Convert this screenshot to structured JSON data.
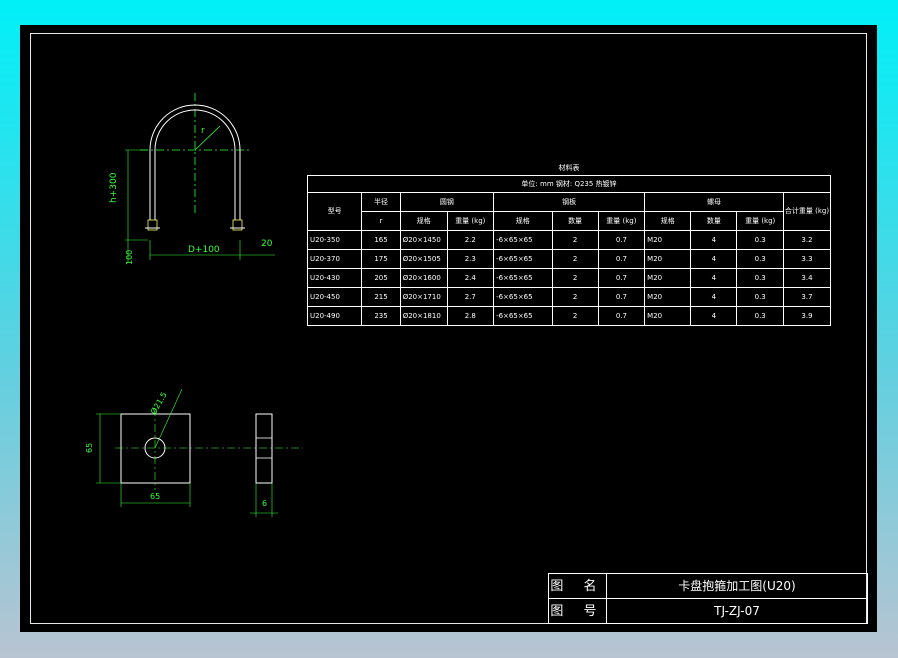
{
  "drawing": {
    "elevation": {
      "radius_label": "r",
      "height_label": "h+300",
      "width_label": "D+100",
      "thread_label": "100",
      "offset_label": "20"
    },
    "plate": {
      "hole_label": "Ø21.5",
      "side_label": "65",
      "bottom_label": "65",
      "thickness_label": "6"
    }
  },
  "table": {
    "title": "材料表",
    "subtitle": "单位: mm     钢材: Q235   热镀锌",
    "headers": {
      "model": "型号",
      "radius": "半径",
      "radius_unit": "r",
      "round_steel": "圆钢",
      "flat_steel": "钢板",
      "nut": "螺母",
      "total_weight": "合计重量 (kg)",
      "spec": "规格",
      "weight_kg": "重量 (kg)",
      "qty": "数量",
      "weight_kg2": "重量 (kg)",
      "spec2": "规格",
      "qty2": "数量",
      "weight_kg3": "重量 (kg)"
    },
    "rows": [
      {
        "model": "U20-350",
        "r": "165",
        "rspec": "Ø20×1450",
        "rw": "2.2",
        "fspec": "-6×65×65",
        "fq": "2",
        "fw": "0.7",
        "nspec": "M20",
        "nq": "4",
        "nw": "0.3",
        "total": "3.2"
      },
      {
        "model": "U20-370",
        "r": "175",
        "rspec": "Ø20×1505",
        "rw": "2.3",
        "fspec": "-6×65×65",
        "fq": "2",
        "fw": "0.7",
        "nspec": "M20",
        "nq": "4",
        "nw": "0.3",
        "total": "3.3"
      },
      {
        "model": "U20-430",
        "r": "205",
        "rspec": "Ø20×1600",
        "rw": "2.4",
        "fspec": "-6×65×65",
        "fq": "2",
        "fw": "0.7",
        "nspec": "M20",
        "nq": "4",
        "nw": "0.3",
        "total": "3.4"
      },
      {
        "model": "U20-450",
        "r": "215",
        "rspec": "Ø20×1710",
        "rw": "2.7",
        "fspec": "-6×65×65",
        "fq": "2",
        "fw": "0.7",
        "nspec": "M20",
        "nq": "4",
        "nw": "0.3",
        "total": "3.7"
      },
      {
        "model": "U20-490",
        "r": "235",
        "rspec": "Ø20×1810",
        "rw": "2.8",
        "fspec": "-6×65×65",
        "fq": "2",
        "fw": "0.7",
        "nspec": "M20",
        "nq": "4",
        "nw": "0.3",
        "total": "3.9"
      }
    ]
  },
  "title_block": {
    "name_label": "图 名",
    "name_value": "卡盘抱箍加工图(U20)",
    "number_label": "图 号",
    "number_value": "TJ-ZJ-07"
  },
  "colors": {
    "background": "#000000",
    "line": "#ffffff",
    "dimension": "#33ff33",
    "centerline": "#33ff33",
    "thread": "#ffff66"
  }
}
